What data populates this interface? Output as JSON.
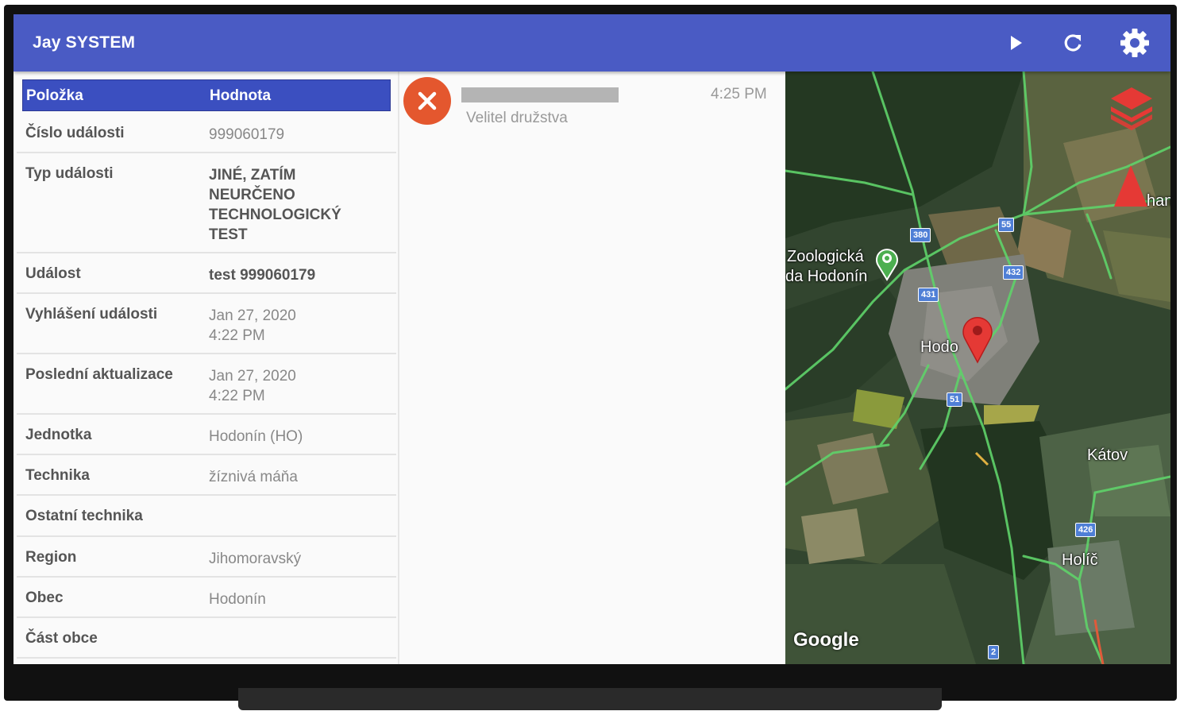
{
  "app": {
    "title": "Jay SYSTEM"
  },
  "toolbar": {
    "play_icon": "play-icon",
    "refresh_icon": "refresh-icon",
    "settings_icon": "gear-icon"
  },
  "table": {
    "headers": {
      "item": "Položka",
      "value": "Hodnota"
    },
    "rows": [
      {
        "key": "Číslo události",
        "value": "999060179"
      },
      {
        "key": "Typ události",
        "value": "JINÉ, ZATÍM NEURČENO TECHNOLOGICKÝ TEST"
      },
      {
        "key": "Událost",
        "value": "test 999060179"
      },
      {
        "key": "Vyhlášení události",
        "value": "Jan 27, 2020 4:22 PM"
      },
      {
        "key": "Poslední aktualizace",
        "value": "Jan 27, 2020 4:22 PM"
      },
      {
        "key": "Jednotka",
        "value": "Hodonín (HO)"
      },
      {
        "key": "Technika",
        "value": "žíznivá máňa"
      },
      {
        "key": "Ostatní technika",
        "value": ""
      },
      {
        "key": "Region",
        "value": "Jihomoravský"
      },
      {
        "key": "Obec",
        "value": "Hodonín"
      },
      {
        "key": "Část obce",
        "value": ""
      }
    ]
  },
  "message": {
    "status_icon": "close-icon",
    "subtitle": "Velitel družstva",
    "time": "4:25 PM"
  },
  "map": {
    "labels": {
      "zoo": "Zoologická",
      "zoo2": "da Hodonín",
      "town": "Hodo",
      "katov": "Kátov",
      "holic": "Holíč",
      "han": "han"
    },
    "shields": [
      "380",
      "55",
      "432",
      "431",
      "51",
      "426",
      "2"
    ],
    "attribution": "Google",
    "colors": {
      "road": "#5fd36a",
      "marker": "#e53935",
      "zoo_pin": "#4caf50"
    }
  }
}
